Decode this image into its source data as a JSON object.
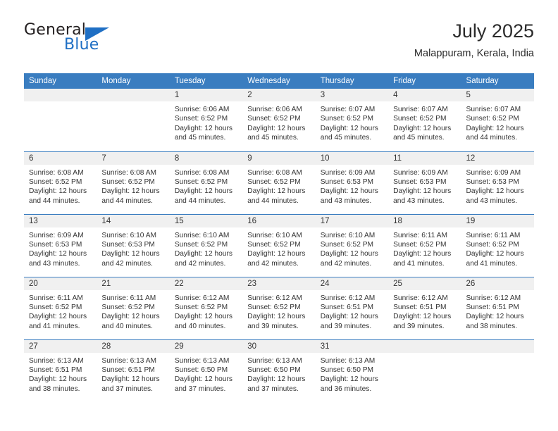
{
  "brand": {
    "name_top": "General",
    "name_bottom": "Blue",
    "accent_color": "#1f6fc4"
  },
  "header": {
    "title": "July 2025",
    "subtitle": "Malappuram, Kerala, India"
  },
  "calendar": {
    "header_bg": "#3a7dc0",
    "daynum_bg": "#f0f0f0",
    "weekdays": [
      "Sunday",
      "Monday",
      "Tuesday",
      "Wednesday",
      "Thursday",
      "Friday",
      "Saturday"
    ],
    "labels": {
      "sunrise": "Sunrise:",
      "sunset": "Sunset:",
      "daylight": "Daylight:"
    },
    "weeks": [
      [
        {
          "day": "",
          "empty": true
        },
        {
          "day": "",
          "empty": true
        },
        {
          "day": "1",
          "sunrise": "Sunrise: 6:06 AM",
          "sunset": "Sunset: 6:52 PM",
          "daylight1": "Daylight: 12 hours",
          "daylight2": "and 45 minutes."
        },
        {
          "day": "2",
          "sunrise": "Sunrise: 6:06 AM",
          "sunset": "Sunset: 6:52 PM",
          "daylight1": "Daylight: 12 hours",
          "daylight2": "and 45 minutes."
        },
        {
          "day": "3",
          "sunrise": "Sunrise: 6:07 AM",
          "sunset": "Sunset: 6:52 PM",
          "daylight1": "Daylight: 12 hours",
          "daylight2": "and 45 minutes."
        },
        {
          "day": "4",
          "sunrise": "Sunrise: 6:07 AM",
          "sunset": "Sunset: 6:52 PM",
          "daylight1": "Daylight: 12 hours",
          "daylight2": "and 45 minutes."
        },
        {
          "day": "5",
          "sunrise": "Sunrise: 6:07 AM",
          "sunset": "Sunset: 6:52 PM",
          "daylight1": "Daylight: 12 hours",
          "daylight2": "and 44 minutes."
        }
      ],
      [
        {
          "day": "6",
          "sunrise": "Sunrise: 6:08 AM",
          "sunset": "Sunset: 6:52 PM",
          "daylight1": "Daylight: 12 hours",
          "daylight2": "and 44 minutes."
        },
        {
          "day": "7",
          "sunrise": "Sunrise: 6:08 AM",
          "sunset": "Sunset: 6:52 PM",
          "daylight1": "Daylight: 12 hours",
          "daylight2": "and 44 minutes."
        },
        {
          "day": "8",
          "sunrise": "Sunrise: 6:08 AM",
          "sunset": "Sunset: 6:52 PM",
          "daylight1": "Daylight: 12 hours",
          "daylight2": "and 44 minutes."
        },
        {
          "day": "9",
          "sunrise": "Sunrise: 6:08 AM",
          "sunset": "Sunset: 6:52 PM",
          "daylight1": "Daylight: 12 hours",
          "daylight2": "and 44 minutes."
        },
        {
          "day": "10",
          "sunrise": "Sunrise: 6:09 AM",
          "sunset": "Sunset: 6:53 PM",
          "daylight1": "Daylight: 12 hours",
          "daylight2": "and 43 minutes."
        },
        {
          "day": "11",
          "sunrise": "Sunrise: 6:09 AM",
          "sunset": "Sunset: 6:53 PM",
          "daylight1": "Daylight: 12 hours",
          "daylight2": "and 43 minutes."
        },
        {
          "day": "12",
          "sunrise": "Sunrise: 6:09 AM",
          "sunset": "Sunset: 6:53 PM",
          "daylight1": "Daylight: 12 hours",
          "daylight2": "and 43 minutes."
        }
      ],
      [
        {
          "day": "13",
          "sunrise": "Sunrise: 6:09 AM",
          "sunset": "Sunset: 6:53 PM",
          "daylight1": "Daylight: 12 hours",
          "daylight2": "and 43 minutes."
        },
        {
          "day": "14",
          "sunrise": "Sunrise: 6:10 AM",
          "sunset": "Sunset: 6:53 PM",
          "daylight1": "Daylight: 12 hours",
          "daylight2": "and 42 minutes."
        },
        {
          "day": "15",
          "sunrise": "Sunrise: 6:10 AM",
          "sunset": "Sunset: 6:52 PM",
          "daylight1": "Daylight: 12 hours",
          "daylight2": "and 42 minutes."
        },
        {
          "day": "16",
          "sunrise": "Sunrise: 6:10 AM",
          "sunset": "Sunset: 6:52 PM",
          "daylight1": "Daylight: 12 hours",
          "daylight2": "and 42 minutes."
        },
        {
          "day": "17",
          "sunrise": "Sunrise: 6:10 AM",
          "sunset": "Sunset: 6:52 PM",
          "daylight1": "Daylight: 12 hours",
          "daylight2": "and 42 minutes."
        },
        {
          "day": "18",
          "sunrise": "Sunrise: 6:11 AM",
          "sunset": "Sunset: 6:52 PM",
          "daylight1": "Daylight: 12 hours",
          "daylight2": "and 41 minutes."
        },
        {
          "day": "19",
          "sunrise": "Sunrise: 6:11 AM",
          "sunset": "Sunset: 6:52 PM",
          "daylight1": "Daylight: 12 hours",
          "daylight2": "and 41 minutes."
        }
      ],
      [
        {
          "day": "20",
          "sunrise": "Sunrise: 6:11 AM",
          "sunset": "Sunset: 6:52 PM",
          "daylight1": "Daylight: 12 hours",
          "daylight2": "and 41 minutes."
        },
        {
          "day": "21",
          "sunrise": "Sunrise: 6:11 AM",
          "sunset": "Sunset: 6:52 PM",
          "daylight1": "Daylight: 12 hours",
          "daylight2": "and 40 minutes."
        },
        {
          "day": "22",
          "sunrise": "Sunrise: 6:12 AM",
          "sunset": "Sunset: 6:52 PM",
          "daylight1": "Daylight: 12 hours",
          "daylight2": "and 40 minutes."
        },
        {
          "day": "23",
          "sunrise": "Sunrise: 6:12 AM",
          "sunset": "Sunset: 6:52 PM",
          "daylight1": "Daylight: 12 hours",
          "daylight2": "and 39 minutes."
        },
        {
          "day": "24",
          "sunrise": "Sunrise: 6:12 AM",
          "sunset": "Sunset: 6:51 PM",
          "daylight1": "Daylight: 12 hours",
          "daylight2": "and 39 minutes."
        },
        {
          "day": "25",
          "sunrise": "Sunrise: 6:12 AM",
          "sunset": "Sunset: 6:51 PM",
          "daylight1": "Daylight: 12 hours",
          "daylight2": "and 39 minutes."
        },
        {
          "day": "26",
          "sunrise": "Sunrise: 6:12 AM",
          "sunset": "Sunset: 6:51 PM",
          "daylight1": "Daylight: 12 hours",
          "daylight2": "and 38 minutes."
        }
      ],
      [
        {
          "day": "27",
          "sunrise": "Sunrise: 6:13 AM",
          "sunset": "Sunset: 6:51 PM",
          "daylight1": "Daylight: 12 hours",
          "daylight2": "and 38 minutes."
        },
        {
          "day": "28",
          "sunrise": "Sunrise: 6:13 AM",
          "sunset": "Sunset: 6:51 PM",
          "daylight1": "Daylight: 12 hours",
          "daylight2": "and 37 minutes."
        },
        {
          "day": "29",
          "sunrise": "Sunrise: 6:13 AM",
          "sunset": "Sunset: 6:50 PM",
          "daylight1": "Daylight: 12 hours",
          "daylight2": "and 37 minutes."
        },
        {
          "day": "30",
          "sunrise": "Sunrise: 6:13 AM",
          "sunset": "Sunset: 6:50 PM",
          "daylight1": "Daylight: 12 hours",
          "daylight2": "and 37 minutes."
        },
        {
          "day": "31",
          "sunrise": "Sunrise: 6:13 AM",
          "sunset": "Sunset: 6:50 PM",
          "daylight1": "Daylight: 12 hours",
          "daylight2": "and 36 minutes."
        },
        {
          "day": "",
          "empty": true
        },
        {
          "day": "",
          "empty": true
        }
      ]
    ]
  }
}
